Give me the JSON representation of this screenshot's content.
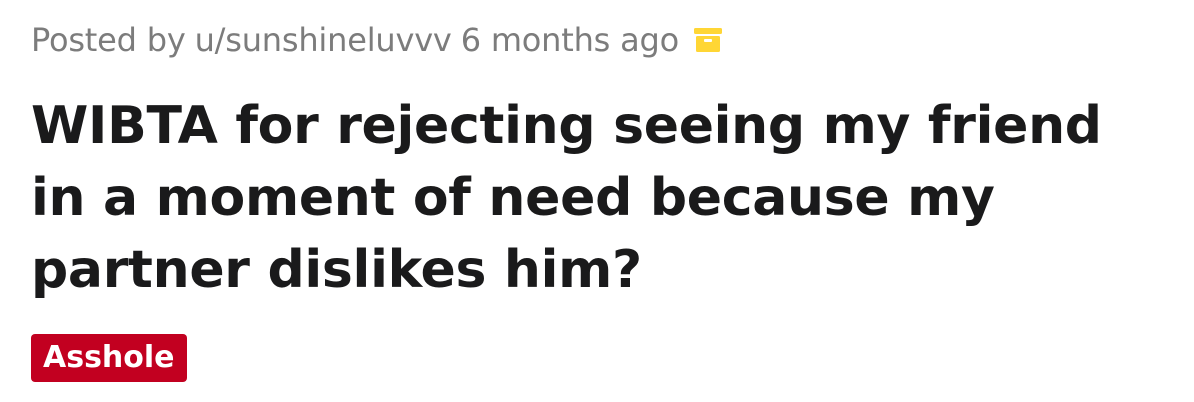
{
  "post": {
    "posted_by_prefix": "Posted by",
    "author": "u/sunshineluvvv",
    "time_ago": "6 months ago",
    "archive_icon": "archive-box-icon",
    "archive_icon_color": "#ffd635",
    "title": "WIBTA for rejecting seeing my friend in a moment of need because my partner dislikes him?",
    "flair": {
      "label": "Asshole",
      "background_color": "#c20020",
      "text_color": "#ffffff"
    }
  }
}
